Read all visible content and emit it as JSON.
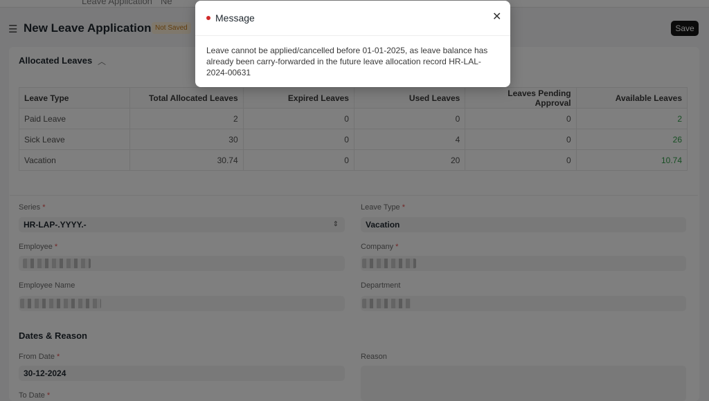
{
  "topbar": {
    "crumb_1": "Leave Application",
    "crumb_2": "Ne"
  },
  "header": {
    "title": "New Leave Application",
    "status": "Not Saved",
    "save_label": "Save"
  },
  "allocated": {
    "heading": "Allocated Leaves",
    "columns": [
      "Leave Type",
      "Total Allocated Leaves",
      "Expired Leaves",
      "Used Leaves",
      "Leaves Pending Approval",
      "Available Leaves"
    ],
    "rows": [
      {
        "type": "Paid Leave",
        "total": "2",
        "expired": "0",
        "used": "0",
        "pending": "0",
        "available": "2"
      },
      {
        "type": "Sick Leave",
        "total": "30",
        "expired": "0",
        "used": "4",
        "pending": "0",
        "available": "26"
      },
      {
        "type": "Vacation",
        "total": "30.74",
        "expired": "0",
        "used": "20",
        "pending": "0",
        "available": "10.74"
      }
    ]
  },
  "form": {
    "series_label": "Series",
    "series_value": "HR-LAP-.YYYY.-",
    "leave_type_label": "Leave Type",
    "leave_type_value": "Vacation",
    "employee_label": "Employee",
    "company_label": "Company",
    "employee_name_label": "Employee Name",
    "department_label": "Department",
    "dates_heading": "Dates & Reason",
    "from_date_label": "From Date",
    "from_date_value": "30-12-2024",
    "reason_label": "Reason",
    "to_date_label": "To Date",
    "required_mark": "*"
  },
  "modal": {
    "title": "Message",
    "close_icon": "close-icon",
    "body": "Leave cannot be applied/cancelled before 01-01-2025, as leave balance has already been carry-forwarded in the future leave allocation record HR-LAL-2024-00631"
  },
  "colors": {
    "indicator_dot": "#d02a2a",
    "available_green": "#2f9d46",
    "not_saved": "#c27a1a"
  }
}
